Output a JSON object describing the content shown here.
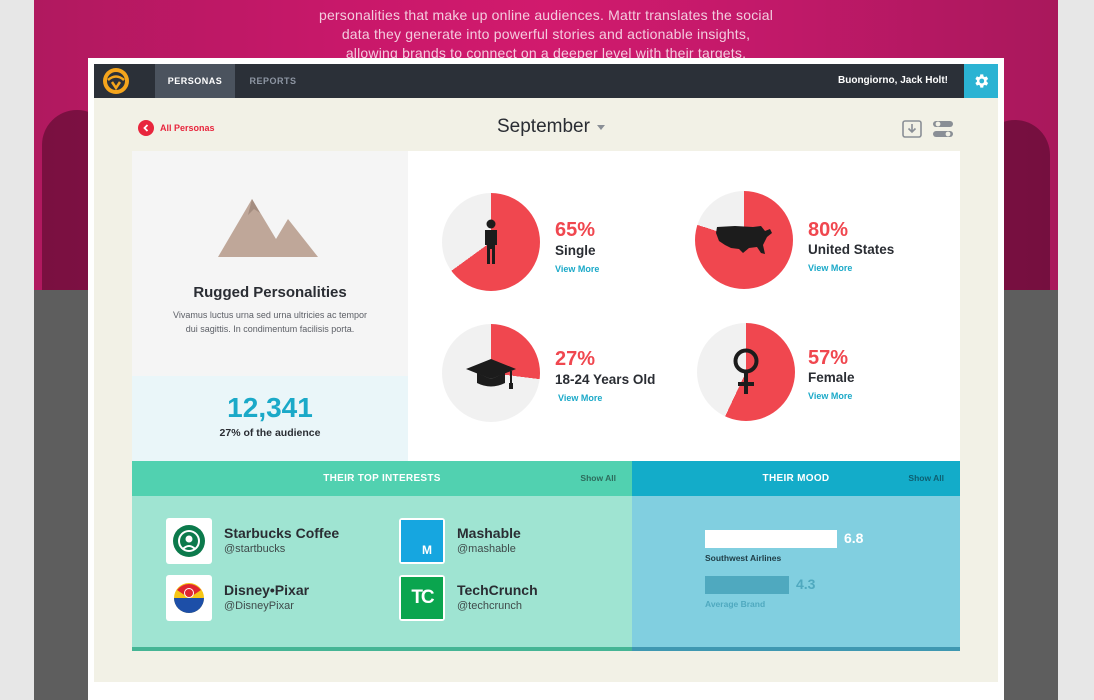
{
  "hero": {
    "text_lines": [
      "personalities that make up online audiences. Mattr translates the social",
      "data they generate into powerful stories and actionable insights,",
      "allowing brands to connect on a deeper level with their targets."
    ]
  },
  "nav": {
    "tabs": [
      {
        "label": "PERSONAS",
        "active": true
      },
      {
        "label": "REPORTS",
        "active": false
      }
    ],
    "greeting": "Buongiorno, Jack Holt!",
    "icons": {
      "logo": "mattr-logo-icon",
      "settings": "gear-icon"
    }
  },
  "subheader": {
    "back_label": "All Personas",
    "month": "September",
    "icons": {
      "back": "chevron-left-icon",
      "download": "download-icon",
      "toggle": "toggle-settings-icon"
    }
  },
  "profile": {
    "icon": "mountain-icon",
    "title": "Rugged Personalities",
    "description": "Vivamus luctus urna sed urna ultricies ac tempor dui sagittis. In condimentum facilisis porta.",
    "count": "12,341",
    "count_sub": "27% of the audience"
  },
  "stats": [
    {
      "percent": "65%",
      "value": 0.65,
      "label": "Single",
      "link": "View More",
      "icon": "person-icon"
    },
    {
      "percent": "80%",
      "value": 0.8,
      "label": "United States",
      "link": "View More",
      "icon": "usa-map-icon"
    },
    {
      "percent": "27%",
      "value": 0.27,
      "label": "18-24 Years Old",
      "link": "View More",
      "icon": "graduation-cap-icon"
    },
    {
      "percent": "57%",
      "value": 0.57,
      "label": "Female",
      "link": "View More",
      "icon": "female-symbol-icon"
    }
  ],
  "interests": {
    "title": "THEIR TOP INTERESTS",
    "show_all": "Show All",
    "items": [
      {
        "name": "Starbucks Coffee",
        "handle": "@startbucks",
        "icon": "starbucks-logo-icon"
      },
      {
        "name": "Mashable",
        "handle": "@mashable",
        "icon": "mashable-logo-icon",
        "mark": "M"
      },
      {
        "name": "Disney•Pixar",
        "handle": "@DisneyPixar",
        "icon": "pixar-ball-icon"
      },
      {
        "name": "TechCrunch",
        "handle": "@techcrunch",
        "icon": "techcrunch-logo-icon",
        "mark": "TC"
      }
    ]
  },
  "mood": {
    "title": "THEIR MOOD",
    "show_all": "Show All",
    "scale_max": 10,
    "bars": [
      {
        "label": "Southwest Airlines",
        "value": 6.8,
        "display": "6.8"
      },
      {
        "label": "Average Brand",
        "value": 4.3,
        "display": "4.3"
      }
    ]
  },
  "colors": {
    "accent_red": "#f0474f",
    "accent_blue": "#1ba9c8",
    "teal": "#51d1b0",
    "mood_blue": "#13acc9",
    "pie_empty": "#f1f1f1"
  }
}
